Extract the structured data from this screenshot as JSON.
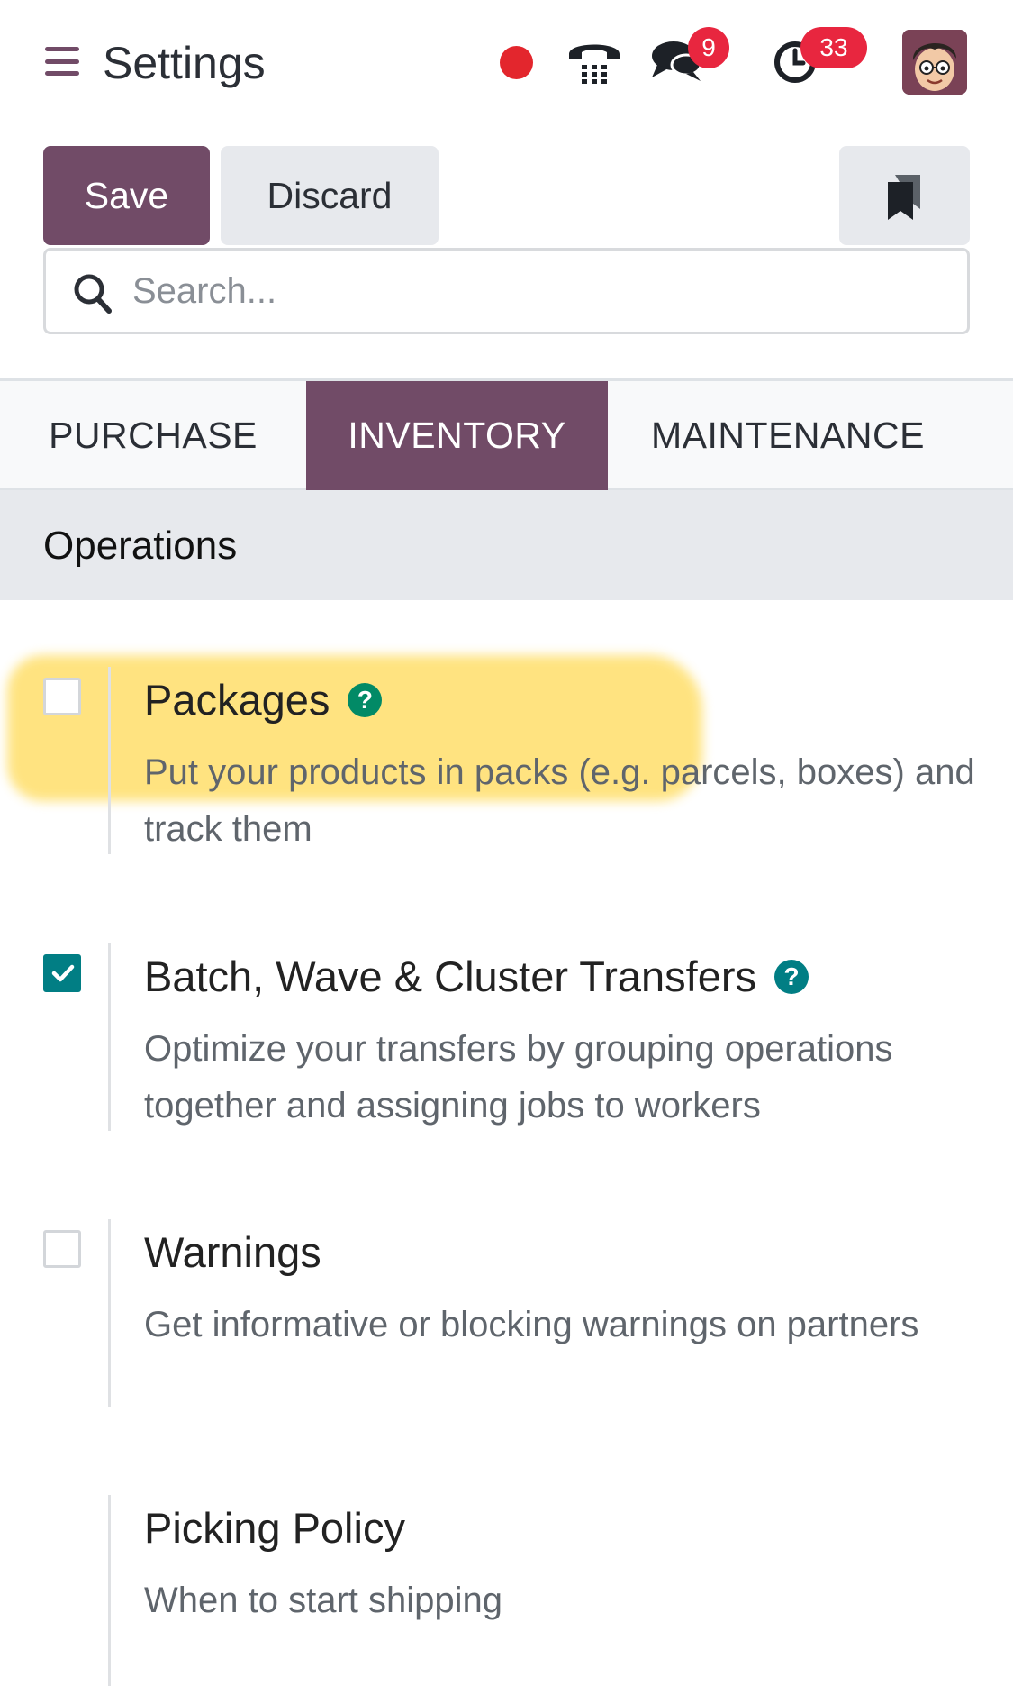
{
  "header": {
    "title": "Settings",
    "chat_count": "9",
    "activity_count": "33",
    "icons": [
      "menu-icon",
      "recording-indicator",
      "phone-icon",
      "chat-icon",
      "clock-icon",
      "avatar"
    ]
  },
  "control_panel": {
    "save_label": "Save",
    "discard_label": "Discard",
    "search_placeholder": "Search..."
  },
  "tabs": [
    {
      "label": "PURCHASE",
      "active": false
    },
    {
      "label": "INVENTORY",
      "active": true
    },
    {
      "label": "MAINTENANCE",
      "active": false
    }
  ],
  "section": {
    "title": "Operations"
  },
  "settings": [
    {
      "title": "Packages",
      "description": "Put your products in packs (e.g. parcels, boxes) and track them",
      "checked": false,
      "has_help": true
    },
    {
      "title": "Batch, Wave & Cluster Transfers",
      "description": "Optimize your transfers by grouping operations together and assigning jobs to workers",
      "checked": true,
      "has_help": true
    },
    {
      "title": "Warnings",
      "description": "Get informative or blocking warnings on partners",
      "checked": false,
      "has_help": false
    },
    {
      "title": "Picking Policy",
      "description": "When to start shipping",
      "checked": null,
      "has_help": false
    }
  ],
  "colors": {
    "brand": "#714B67",
    "checkbox_checked": "#017e84",
    "badge": "#e8263f",
    "highlight": "#ffe27a",
    "help_icon": "#028a66"
  }
}
